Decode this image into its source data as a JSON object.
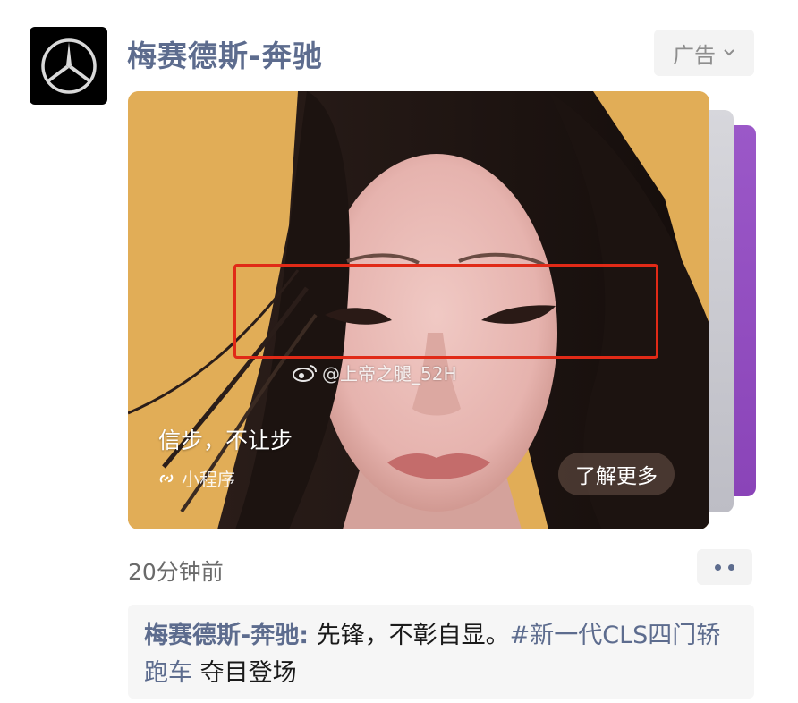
{
  "post": {
    "account_name": "梅赛德斯-奔驰",
    "ad_label": "广告",
    "timestamp": "20分钟前"
  },
  "card": {
    "watermark": "@上帝之腿_52H",
    "slogan": "信步，不让步",
    "miniprogram_label": "小程序",
    "cta_label": "了解更多"
  },
  "comment": {
    "author": "梅赛德斯-奔驰",
    "separator": ":",
    "text": " 先锋，不彰自显。",
    "hashtag": "#新一代CLS四门轿跑车",
    "suffix": " 夺目登场"
  },
  "icons": {
    "avatar": "mercedes-star-icon",
    "ad_dropdown": "chevron-down-icon",
    "watermark": "weibo-icon",
    "miniprogram": "link-icon",
    "more": "more-dots-icon"
  },
  "colors": {
    "link_blue": "#5d6c8e",
    "highlight_red": "#e12a17",
    "card_bg": "#e0ae55",
    "card_stack_purple": "#9b58c8"
  }
}
